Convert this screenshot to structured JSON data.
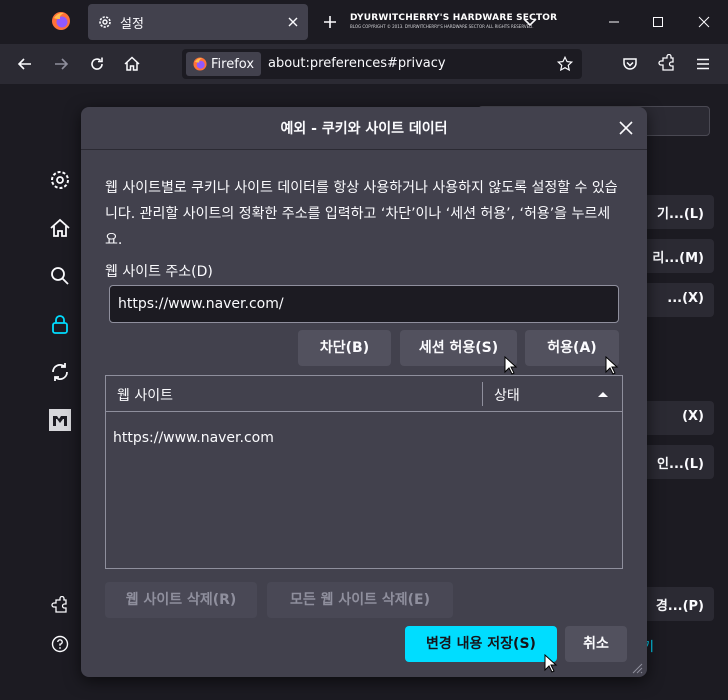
{
  "tab": {
    "title": "설정"
  },
  "banner": {
    "line1": "DYURWITCHERRY'S HARDWARE SECTOR",
    "line2": "BLOG COPYRIGHT © 2013. DYURWITCHERRY'S HARDWARE SECTOR ALL RIGHTS RESERVED."
  },
  "urlbar": {
    "identity_label": "Firefox",
    "url": "about:preferences#privacy"
  },
  "page": {
    "bg_buttons": [
      "기...(L)",
      "리...(M)",
      "...(X)",
      "(X)",
      "인...(L)",
      "경...(P)"
    ],
    "bg_link": "보기"
  },
  "dialog": {
    "title": "예외 - 쿠키와 사이트 데이터",
    "description": "웹 사이트별로 쿠키나 사이트 데이터를 항상 사용하거나 사용하지 않도록 설정할 수 있습니다. 관리할 사이트의 정확한 주소를 입력하고 ‘차단’이나 ‘세션 허용’, ‘허용’을 누르세요.",
    "address_label": "웹 사이트 주소(D)",
    "address_value": "https://www.naver.com/",
    "buttons": {
      "block": "차단(B)",
      "session": "세션 허용(S)",
      "allow": "허용(A)"
    },
    "table": {
      "columns": [
        "웹 사이트",
        "상태"
      ],
      "rows": [
        {
          "site": "https://www.naver.com",
          "status": ""
        }
      ]
    },
    "remove_site": "웹 사이트 삭제(R)",
    "remove_all": "모든 웹 사이트 삭제(E)",
    "save": "변경 내용 저장(S)",
    "cancel": "취소"
  },
  "colors": {
    "accent": "#00ddff",
    "dialog_bg": "#42414d",
    "page_bg": "#1c1b22",
    "toolbar_bg": "#2b2a33"
  }
}
